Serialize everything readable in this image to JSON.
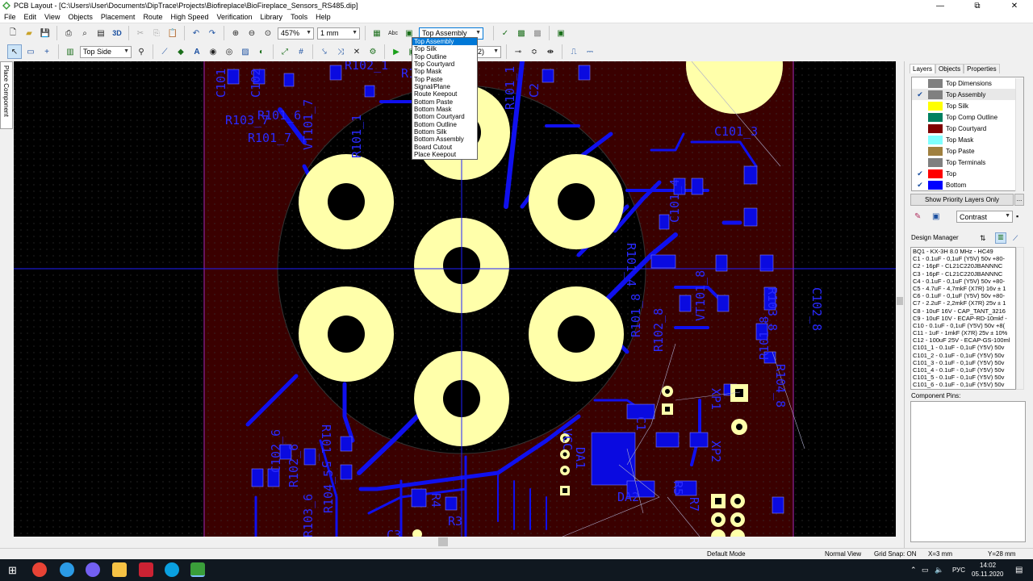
{
  "window": {
    "title": "PCB Layout - [C:\\Users\\User\\Documents\\DipTrace\\Projects\\Biofireplace\\BioFireplace_Sensors_RS485.dip]",
    "minimize": "—",
    "restore": "⧉",
    "close": "✕"
  },
  "menu": [
    "File",
    "Edit",
    "View",
    "Objects",
    "Placement",
    "Route",
    "High Speed",
    "Verification",
    "Library",
    "Tools",
    "Help"
  ],
  "toolbar": {
    "zoom_value": "457%",
    "grid_value": "1 mm",
    "layer_select": "Top Assembly",
    "side_select": "Top Side",
    "route_layer_select": "(2)",
    "btn_3d": "3D",
    "btn_abc": "Abc"
  },
  "dropdown_options": [
    "Top Assembly",
    "Top Silk",
    "Top Outline",
    "Top Courtyard",
    "Top Mask",
    "Top Paste",
    "Signal/Plane",
    "Route Keepout",
    "Bottom Paste",
    "Bottom Mask",
    "Bottom Courtyard",
    "Bottom Outline",
    "Bottom Silk",
    "Bottom Assembly",
    "Board Cutout",
    "Place Keepout"
  ],
  "left_tab": "Place Component",
  "panel": {
    "tabs": [
      "Layers",
      "Objects",
      "Properties"
    ],
    "layers": [
      {
        "name": "Top Dimensions",
        "color": "#808080",
        "checked": false
      },
      {
        "name": "Top Assembly",
        "color": "#808080",
        "checked": true
      },
      {
        "name": "Top Silk",
        "color": "#ffff00",
        "checked": false
      },
      {
        "name": "Top Comp Outline",
        "color": "#008060",
        "checked": false
      },
      {
        "name": "Top Courtyard",
        "color": "#800000",
        "checked": false
      },
      {
        "name": "Top Mask",
        "color": "#80ffff",
        "checked": false
      },
      {
        "name": "Top Paste",
        "color": "#a08040",
        "checked": false
      },
      {
        "name": "Top Terminals",
        "color": "#808080",
        "checked": false
      },
      {
        "name": "Top",
        "color": "#ff0000",
        "checked": true
      },
      {
        "name": "Bottom",
        "color": "#0000ff",
        "checked": true
      }
    ],
    "priority_button": "Show Priority Layers Only",
    "dots_button": "...",
    "contrast_select": "Contrast",
    "design_manager_title": "Design Manager",
    "design_manager_items": [
      "BQ1 - KX-3H 8.0 MHz - HC49",
      "C1 - 0.1uF - 0,1uF (Y5V) 50v +80-",
      "C2 - 16pF - CL21C220JBANNNC",
      "C3 - 16pF - CL21C220JBANNNC",
      "C4 - 0.1uF - 0,1uF (Y5V) 50v +80-",
      "C5 - 4.7uF - 4,7mkF (X7R) 16v ± 1",
      "C6 - 0.1uF - 0,1uF (Y5V) 50v +80-",
      "C7 - 2.2uF - 2,2mkF (X7R) 25v ± 1",
      "C8 - 10uF 16V - CAP_TANT_3216",
      "C9 - 10uF 10V - ECAP-RD-10mkf -",
      "C10 - 0.1uF - 0,1uF (Y5V) 50v +8(",
      "C11 - 1uF - 1mkF (X7R) 25v ± 10%",
      "C12 - 100uF 25V - ECAP-GS-100ml",
      "C101_1 - 0.1uF - 0,1uF (Y5V) 50v",
      "C101_2 - 0.1uF - 0,1uF (Y5V) 50v",
      "C101_3 - 0.1uF - 0,1uF (Y5V) 50v",
      "C101_4 - 0.1uF - 0,1uF (Y5V) 50v",
      "C101_5 - 0.1uF - 0,1uF (Y5V) 50v",
      "C101_6 - 0.1uF - 0,1uF (Y5V) 50v"
    ],
    "component_pins_title": "Component Pins:"
  },
  "status": {
    "mode": "Default Mode",
    "view": "Normal View",
    "grid_snap": "Grid Snap: ON",
    "x": "X=3 mm",
    "y": "Y=28 mm"
  },
  "taskbar": {
    "lang": "РУС",
    "time": "14:02",
    "date": "05.11.2020"
  },
  "pcb_labels": {
    "c101": "C101",
    "r101_6": "R101_6",
    "r101_7": "R101_7",
    "r103_7": "R103_7",
    "vt101_7": "VT101_7",
    "c102_7": "C102_7",
    "r101_1": "R101_1",
    "r101_4": "R101_4",
    "r101_8": "R101_8",
    "r102_8": "R102_8",
    "vt101_8": "VT101_8",
    "c101_3": "C101_3",
    "c101_4": "C101_4",
    "c102_8": "C102_8",
    "r103_8": "R103_8",
    "r104_8": "R104_8",
    "xp1": "XP1",
    "xp2": "XP2",
    "c1": "C1",
    "da1": "DA1",
    "da2": "DA2",
    "r5": "R5",
    "r7": "R7",
    "c102_6": "C102_6",
    "r102_6": "R102_6",
    "r103_6": "R103_6",
    "r101_5": "R101_5",
    "r104_5": "R104_5",
    "r4": "R4",
    "r3": "R3",
    "c3": "C3",
    "vcc": "VCC",
    "r102_1": "R102_1",
    "c102": "C102",
    "r1": "R1",
    "c2": "C2"
  }
}
